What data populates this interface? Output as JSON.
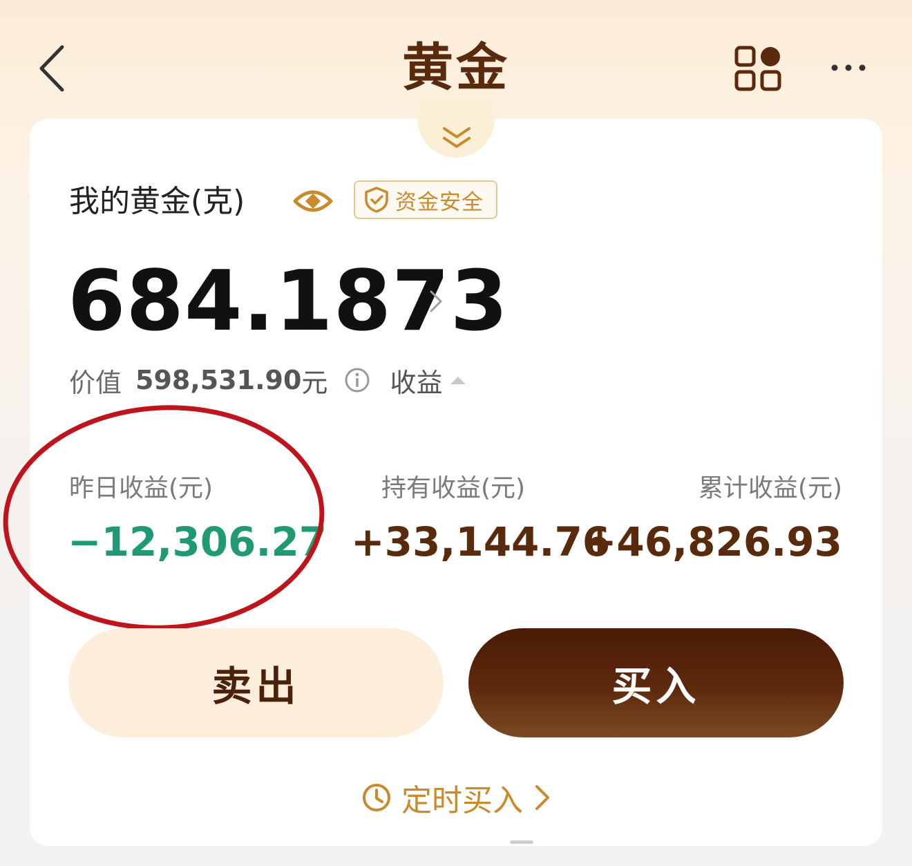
{
  "header": {
    "title": "黄金"
  },
  "holdings": {
    "label": "我的黄金(克)",
    "badge": "资金安全",
    "grams": "684.1873",
    "value_label": "价值",
    "value_amount": "598,531.90",
    "value_unit": "元",
    "income_toggle": "收益"
  },
  "stats": [
    {
      "label": "昨日收益(元)",
      "value": "−12,306.27"
    },
    {
      "label": "持有收益(元)",
      "value": "+33,144.76"
    },
    {
      "label": "累计收益(元)",
      "value": "+46,826.93"
    }
  ],
  "actions": {
    "sell": "卖出",
    "buy": "买入"
  },
  "scheduled_buy": "定时买入",
  "colors": {
    "brown": "#5a2a0c",
    "gold": "#c98a2c",
    "loss_green": "#1f9a72",
    "highlight_red": "#c0141c"
  },
  "icons": [
    "back-icon",
    "grid-icon",
    "more-icon",
    "chevron-double-down-icon",
    "eye-icon",
    "shield-check-icon",
    "chevron-right-icon",
    "info-icon",
    "caret-up-icon",
    "clock-icon"
  ]
}
